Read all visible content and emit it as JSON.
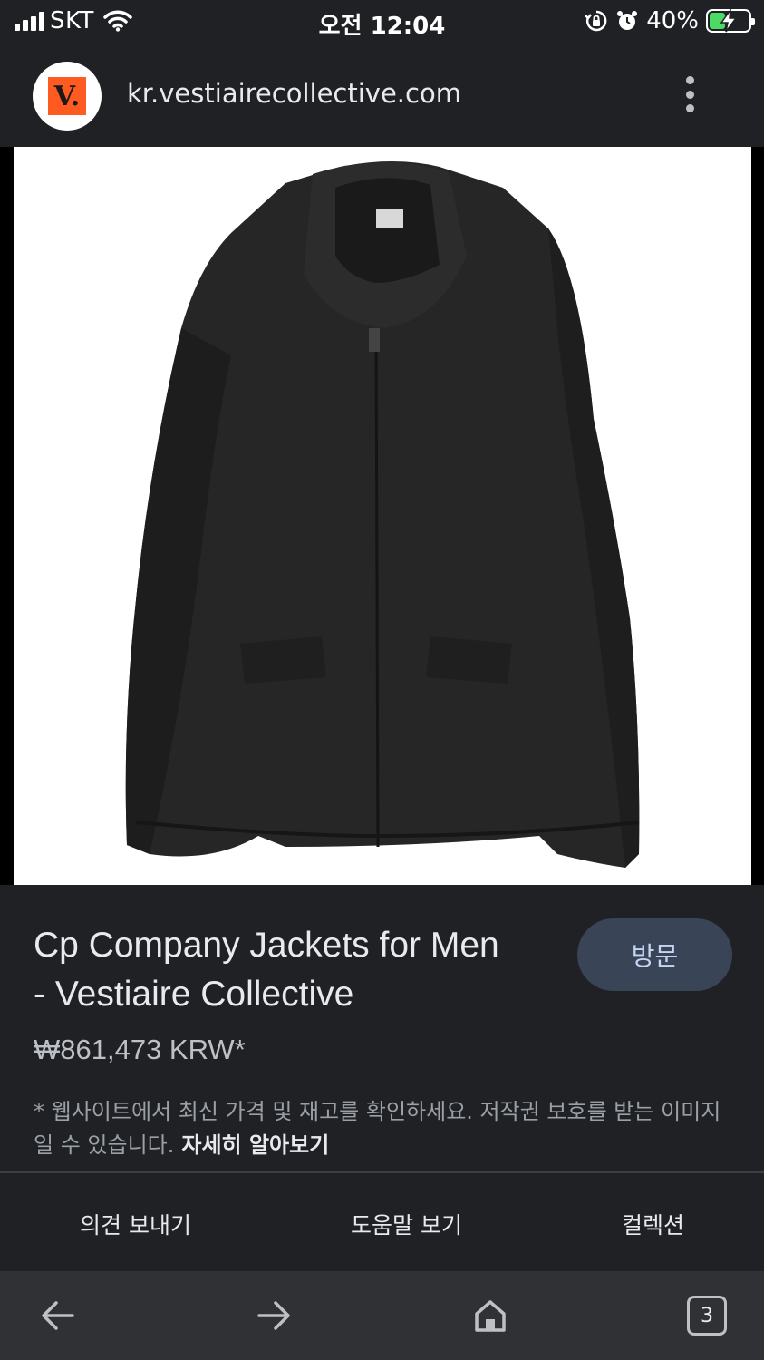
{
  "status_bar": {
    "carrier": "SKT",
    "time": "오전 12:04",
    "battery": "40%",
    "battery_level": 0.4
  },
  "site": {
    "logo_text": "V.",
    "url": "kr.vestiairecollective.com"
  },
  "product": {
    "image_icon": "black-jacket-image",
    "title_line1": "Cp Company Jackets for Men",
    "title_line2": "- Vestiaire Collective",
    "price": "₩861,473 KRW*",
    "visit_label": "방문"
  },
  "disclaimer": {
    "text": "* 웹사이트에서 최신 가격 및 재고를 확인하세요. 저작권 보호를 받는 이미지일 수 있습니다.",
    "learn_more": "자세히 알아보기"
  },
  "footer_links": {
    "feedback": "의견 보내기",
    "help": "도움말 보기",
    "collections": "컬렉션"
  },
  "toolbar": {
    "tab_count": "3"
  },
  "colors": {
    "background": "#202124",
    "toolbar": "#303134",
    "visit_button": "#394457",
    "logo_accent": "#ff5a1f",
    "battery": "#4cd964"
  }
}
